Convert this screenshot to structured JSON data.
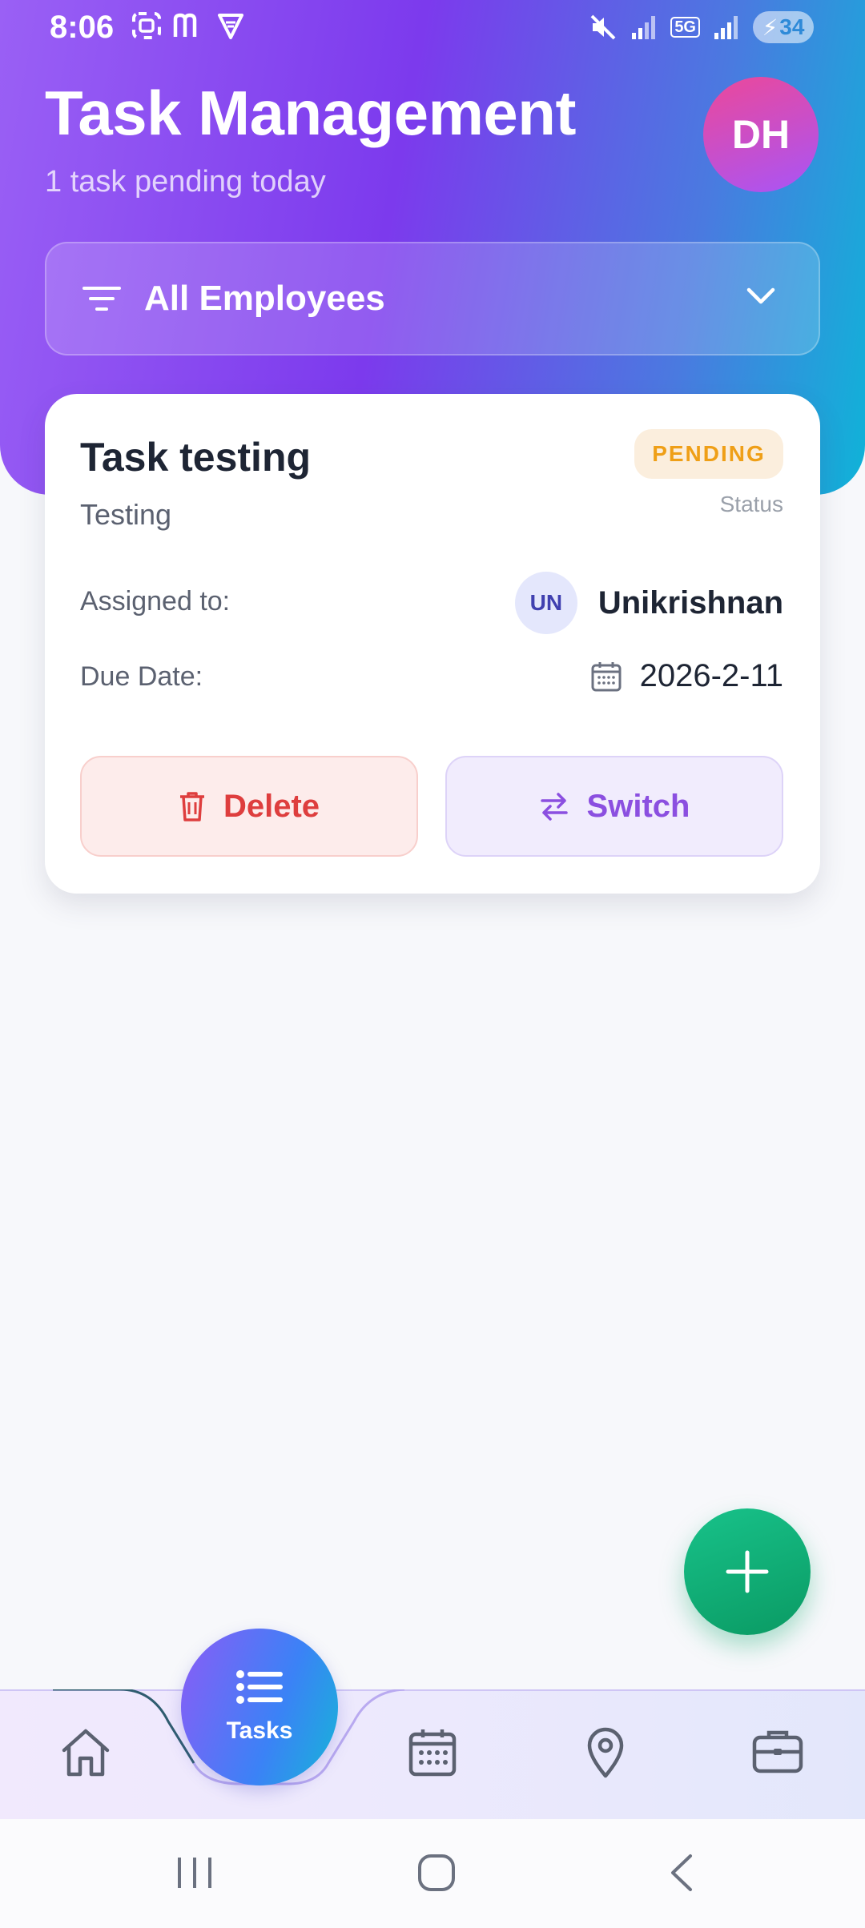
{
  "status_bar": {
    "time": "8:06",
    "network": "5G",
    "battery": "34",
    "left_icons": [
      "screenshot-icon",
      "m-app-icon",
      "vpn-shield-icon"
    ],
    "right_icons": [
      "mute-icon",
      "signal-icon",
      "signal-icon",
      "battery-icon"
    ]
  },
  "header": {
    "title": "Task Management",
    "subtitle": "1 task pending today",
    "avatar_initials": "DH"
  },
  "filter": {
    "label": "All Employees",
    "icon": "filter-icon",
    "chevron": "chevron-down-icon"
  },
  "task": {
    "title": "Task testing",
    "status": "PENDING",
    "status_caption": "Status",
    "description": "Testing",
    "assigned_label": "Assigned to:",
    "assignee_initials": "UN",
    "assignee_name": "Unikrishnan",
    "due_label": "Due Date:",
    "due_date": "2026-2-11",
    "delete_label": "Delete",
    "switch_label": "Switch"
  },
  "bottom_nav": {
    "active_label": "Tasks",
    "items": [
      "home-icon",
      "tasks-icon",
      "calendar-icon",
      "location-icon",
      "briefcase-icon"
    ]
  },
  "colors": {
    "header_gradient_start": "#9a60f5",
    "header_gradient_end": "#0fb3d8",
    "pending": "#ef9f17",
    "delete": "#de3e3e",
    "switch": "#8b4fe0",
    "fab": "#10b07a"
  }
}
